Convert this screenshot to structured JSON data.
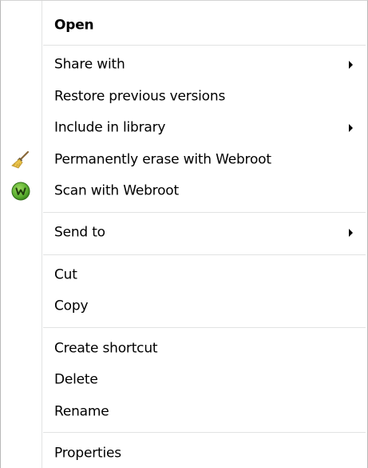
{
  "menu": {
    "items": [
      {
        "label": "Open",
        "bold": true
      },
      {
        "label": "Share with",
        "submenu": true
      },
      {
        "label": "Restore previous versions"
      },
      {
        "label": "Include in library",
        "submenu": true
      },
      {
        "label": "Permanently erase with Webroot",
        "icon": "broom-icon"
      },
      {
        "label": "Scan with Webroot",
        "icon": "webroot-icon"
      },
      {
        "label": "Send to",
        "submenu": true
      },
      {
        "label": "Cut"
      },
      {
        "label": "Copy"
      },
      {
        "label": "Create shortcut"
      },
      {
        "label": "Delete"
      },
      {
        "label": "Rename"
      },
      {
        "label": "Properties"
      }
    ]
  },
  "colors": {
    "separator": "#e2e3e3",
    "border": "#b8b8b8",
    "webroot_green": "#5cb031"
  }
}
